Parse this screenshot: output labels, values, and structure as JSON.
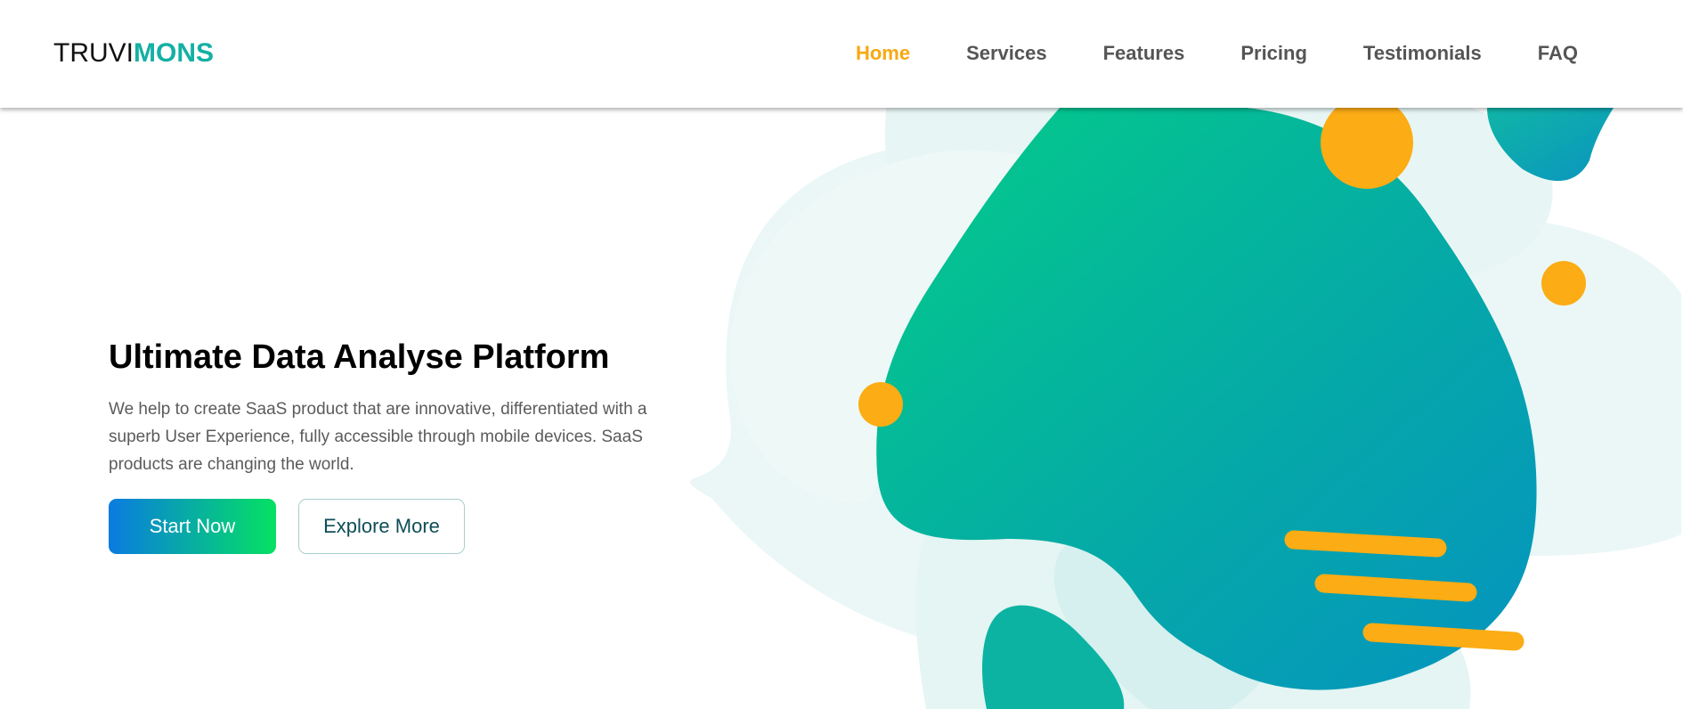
{
  "header": {
    "logo": {
      "part1": "TRUVI",
      "part2": "MONS"
    },
    "nav": [
      {
        "label": "Home",
        "active": true
      },
      {
        "label": "Services",
        "active": false
      },
      {
        "label": "Features",
        "active": false
      },
      {
        "label": "Pricing",
        "active": false
      },
      {
        "label": "Testimonials",
        "active": false
      },
      {
        "label": "FAQ",
        "active": false
      }
    ]
  },
  "hero": {
    "title": "Ultimate Data Analyse Platform",
    "description": "We help to create SaaS product that are innovative, differentiated with a superb User Experience, fully accessible through mobile devices. SaaS products are changing the world.",
    "primary_button": "Start Now",
    "secondary_button": "Explore More"
  },
  "colors": {
    "accent": "#f7a912",
    "brand_teal": "#14b0a4",
    "blob_gradient_start": "#05c48e",
    "blob_gradient_end": "#0497bd",
    "button_gradient_start": "#0a7be0",
    "button_gradient_end": "#05e163"
  }
}
